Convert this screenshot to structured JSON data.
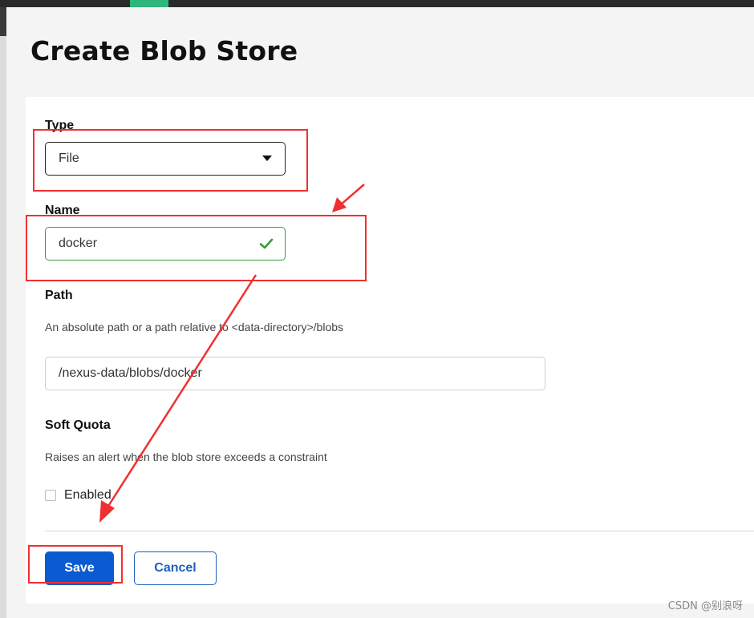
{
  "page": {
    "title": "Create Blob Store"
  },
  "form": {
    "type_label": "Type",
    "type_value": "File",
    "name_label": "Name",
    "name_value": "docker",
    "path_label": "Path",
    "path_help": "An absolute path or a path relative to <data-directory>/blobs",
    "path_value": "/nexus-data/blobs/docker",
    "soft_quota_label": "Soft Quota",
    "soft_quota_help": "Raises an alert when the blob store exceeds a constraint",
    "enabled_label": "Enabled",
    "enabled_checked": false
  },
  "actions": {
    "save_label": "Save",
    "cancel_label": "Cancel"
  },
  "watermark": "CSDN @别浪呀",
  "colors": {
    "primary": "#0a5bd1",
    "valid": "#3a9a3a",
    "annotation": "#f03030",
    "accent": "#2fb67c"
  },
  "icons": {
    "dropdown": "caret-down-icon",
    "valid": "check-icon"
  }
}
